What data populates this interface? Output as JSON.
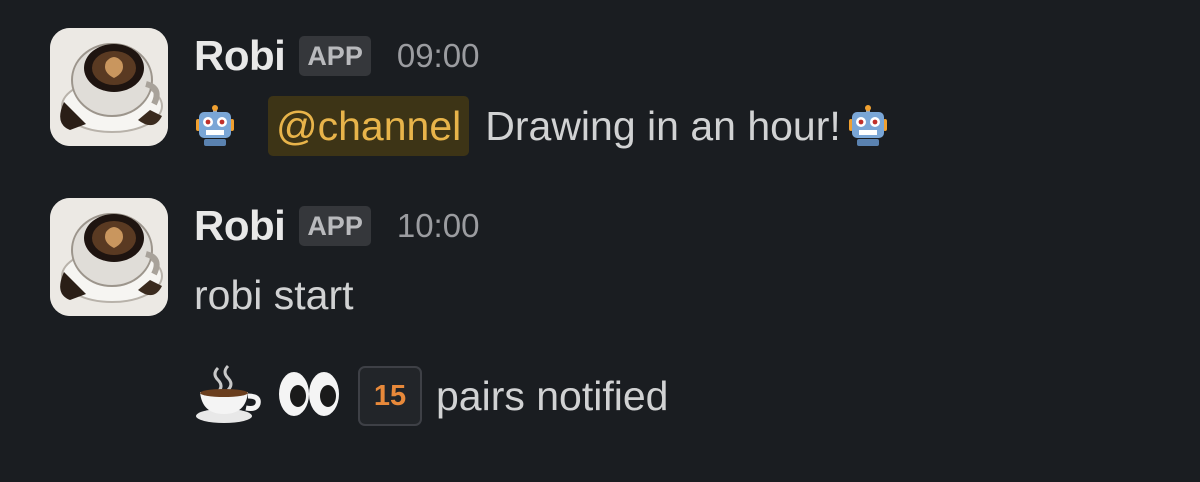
{
  "messages": [
    {
      "author": "Robi",
      "badge": "APP",
      "time": "09:00",
      "mention": "@channel",
      "text": "Drawing in an hour!",
      "leading_icon": "robot-face-icon",
      "trailing_icon": "robot-face-icon"
    },
    {
      "author": "Robi",
      "badge": "APP",
      "time": "10:00",
      "text": "robi start",
      "reactions": {
        "icons": [
          "coffee-cup-icon",
          "eyes-icon"
        ],
        "count": "15",
        "label": "pairs notified"
      }
    }
  ],
  "colors": {
    "background": "#1a1d21",
    "mention_text": "#e8b44a",
    "mention_bg": "#3d3416",
    "count_text": "#e8893a"
  }
}
